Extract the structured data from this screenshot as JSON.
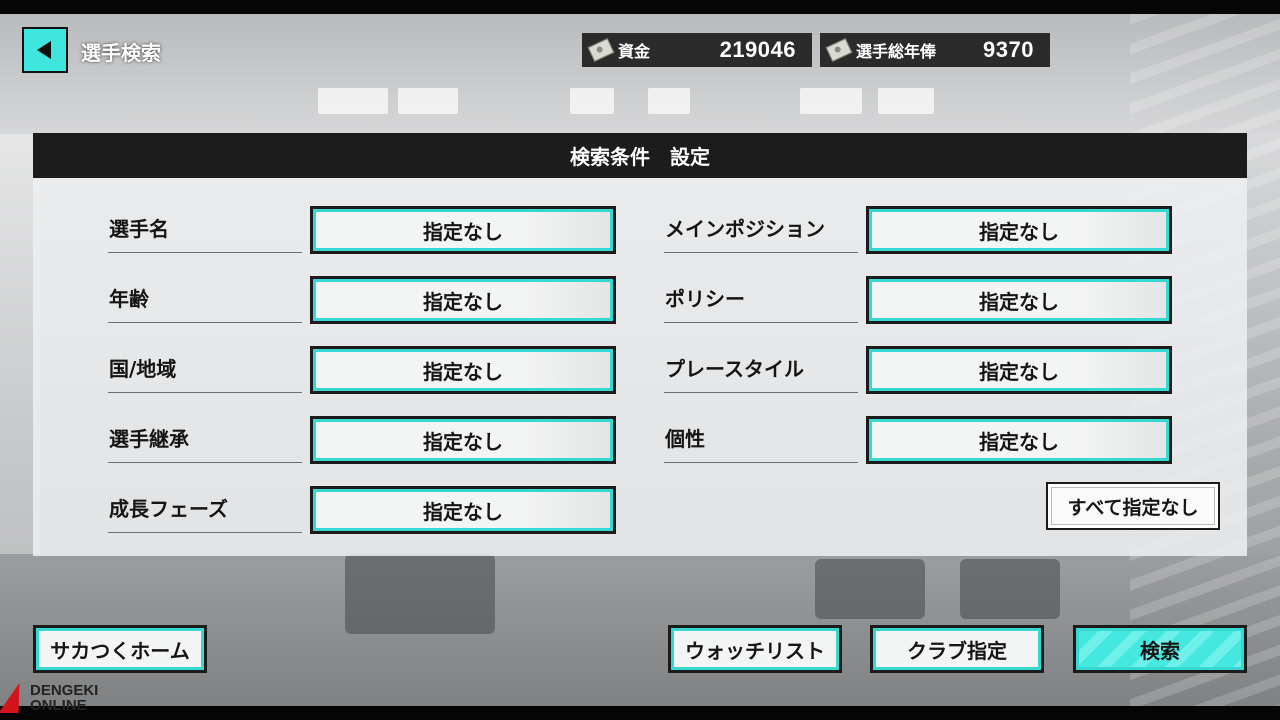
{
  "top_bar": {
    "title": "選手検索",
    "funds": {
      "label": "資金",
      "value": "219046"
    },
    "salary_total": {
      "label": "選手総年俸",
      "value": "9370"
    }
  },
  "panel": {
    "title": "検索条件　設定",
    "fields_left": [
      {
        "label": "選手名",
        "value": "指定なし"
      },
      {
        "label": "年齢",
        "value": "指定なし"
      },
      {
        "label": "国/地域",
        "value": "指定なし"
      },
      {
        "label": "選手継承",
        "value": "指定なし"
      },
      {
        "label": "成長フェーズ",
        "value": "指定なし"
      }
    ],
    "fields_right": [
      {
        "label": "メインポジション",
        "value": "指定なし"
      },
      {
        "label": "ポリシー",
        "value": "指定なし"
      },
      {
        "label": "プレースタイル",
        "value": "指定なし"
      },
      {
        "label": "個性",
        "value": "指定なし"
      }
    ],
    "clear_all_label": "すべて指定なし"
  },
  "bottom": {
    "home_label": "サカつくホーム",
    "watchlist_label": "ウォッチリスト",
    "club_label": "クラブ指定",
    "search_label": "検索"
  },
  "watermark": {
    "line1": "DENGEKI",
    "line2": "ONLINE"
  },
  "colors": {
    "accent": "#36d9d2",
    "panel_header": "#1c1c1c"
  }
}
